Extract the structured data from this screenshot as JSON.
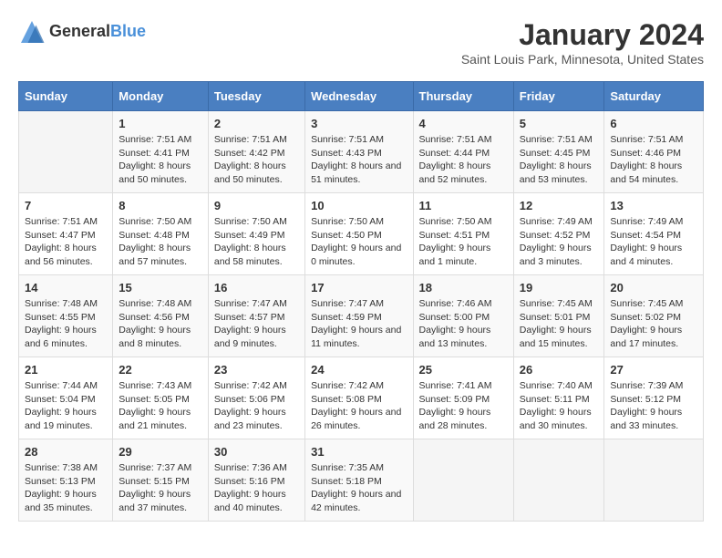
{
  "header": {
    "logo_general": "General",
    "logo_blue": "Blue",
    "month_title": "January 2024",
    "location": "Saint Louis Park, Minnesota, United States"
  },
  "days_of_week": [
    "Sunday",
    "Monday",
    "Tuesday",
    "Wednesday",
    "Thursday",
    "Friday",
    "Saturday"
  ],
  "weeks": [
    [
      {
        "day": "",
        "sunrise": "",
        "sunset": "",
        "daylight": ""
      },
      {
        "day": "1",
        "sunrise": "Sunrise: 7:51 AM",
        "sunset": "Sunset: 4:41 PM",
        "daylight": "Daylight: 8 hours and 50 minutes."
      },
      {
        "day": "2",
        "sunrise": "Sunrise: 7:51 AM",
        "sunset": "Sunset: 4:42 PM",
        "daylight": "Daylight: 8 hours and 50 minutes."
      },
      {
        "day": "3",
        "sunrise": "Sunrise: 7:51 AM",
        "sunset": "Sunset: 4:43 PM",
        "daylight": "Daylight: 8 hours and 51 minutes."
      },
      {
        "day": "4",
        "sunrise": "Sunrise: 7:51 AM",
        "sunset": "Sunset: 4:44 PM",
        "daylight": "Daylight: 8 hours and 52 minutes."
      },
      {
        "day": "5",
        "sunrise": "Sunrise: 7:51 AM",
        "sunset": "Sunset: 4:45 PM",
        "daylight": "Daylight: 8 hours and 53 minutes."
      },
      {
        "day": "6",
        "sunrise": "Sunrise: 7:51 AM",
        "sunset": "Sunset: 4:46 PM",
        "daylight": "Daylight: 8 hours and 54 minutes."
      }
    ],
    [
      {
        "day": "7",
        "sunrise": "Sunrise: 7:51 AM",
        "sunset": "Sunset: 4:47 PM",
        "daylight": "Daylight: 8 hours and 56 minutes."
      },
      {
        "day": "8",
        "sunrise": "Sunrise: 7:50 AM",
        "sunset": "Sunset: 4:48 PM",
        "daylight": "Daylight: 8 hours and 57 minutes."
      },
      {
        "day": "9",
        "sunrise": "Sunrise: 7:50 AM",
        "sunset": "Sunset: 4:49 PM",
        "daylight": "Daylight: 8 hours and 58 minutes."
      },
      {
        "day": "10",
        "sunrise": "Sunrise: 7:50 AM",
        "sunset": "Sunset: 4:50 PM",
        "daylight": "Daylight: 9 hours and 0 minutes."
      },
      {
        "day": "11",
        "sunrise": "Sunrise: 7:50 AM",
        "sunset": "Sunset: 4:51 PM",
        "daylight": "Daylight: 9 hours and 1 minute."
      },
      {
        "day": "12",
        "sunrise": "Sunrise: 7:49 AM",
        "sunset": "Sunset: 4:52 PM",
        "daylight": "Daylight: 9 hours and 3 minutes."
      },
      {
        "day": "13",
        "sunrise": "Sunrise: 7:49 AM",
        "sunset": "Sunset: 4:54 PM",
        "daylight": "Daylight: 9 hours and 4 minutes."
      }
    ],
    [
      {
        "day": "14",
        "sunrise": "Sunrise: 7:48 AM",
        "sunset": "Sunset: 4:55 PM",
        "daylight": "Daylight: 9 hours and 6 minutes."
      },
      {
        "day": "15",
        "sunrise": "Sunrise: 7:48 AM",
        "sunset": "Sunset: 4:56 PM",
        "daylight": "Daylight: 9 hours and 8 minutes."
      },
      {
        "day": "16",
        "sunrise": "Sunrise: 7:47 AM",
        "sunset": "Sunset: 4:57 PM",
        "daylight": "Daylight: 9 hours and 9 minutes."
      },
      {
        "day": "17",
        "sunrise": "Sunrise: 7:47 AM",
        "sunset": "Sunset: 4:59 PM",
        "daylight": "Daylight: 9 hours and 11 minutes."
      },
      {
        "day": "18",
        "sunrise": "Sunrise: 7:46 AM",
        "sunset": "Sunset: 5:00 PM",
        "daylight": "Daylight: 9 hours and 13 minutes."
      },
      {
        "day": "19",
        "sunrise": "Sunrise: 7:45 AM",
        "sunset": "Sunset: 5:01 PM",
        "daylight": "Daylight: 9 hours and 15 minutes."
      },
      {
        "day": "20",
        "sunrise": "Sunrise: 7:45 AM",
        "sunset": "Sunset: 5:02 PM",
        "daylight": "Daylight: 9 hours and 17 minutes."
      }
    ],
    [
      {
        "day": "21",
        "sunrise": "Sunrise: 7:44 AM",
        "sunset": "Sunset: 5:04 PM",
        "daylight": "Daylight: 9 hours and 19 minutes."
      },
      {
        "day": "22",
        "sunrise": "Sunrise: 7:43 AM",
        "sunset": "Sunset: 5:05 PM",
        "daylight": "Daylight: 9 hours and 21 minutes."
      },
      {
        "day": "23",
        "sunrise": "Sunrise: 7:42 AM",
        "sunset": "Sunset: 5:06 PM",
        "daylight": "Daylight: 9 hours and 23 minutes."
      },
      {
        "day": "24",
        "sunrise": "Sunrise: 7:42 AM",
        "sunset": "Sunset: 5:08 PM",
        "daylight": "Daylight: 9 hours and 26 minutes."
      },
      {
        "day": "25",
        "sunrise": "Sunrise: 7:41 AM",
        "sunset": "Sunset: 5:09 PM",
        "daylight": "Daylight: 9 hours and 28 minutes."
      },
      {
        "day": "26",
        "sunrise": "Sunrise: 7:40 AM",
        "sunset": "Sunset: 5:11 PM",
        "daylight": "Daylight: 9 hours and 30 minutes."
      },
      {
        "day": "27",
        "sunrise": "Sunrise: 7:39 AM",
        "sunset": "Sunset: 5:12 PM",
        "daylight": "Daylight: 9 hours and 33 minutes."
      }
    ],
    [
      {
        "day": "28",
        "sunrise": "Sunrise: 7:38 AM",
        "sunset": "Sunset: 5:13 PM",
        "daylight": "Daylight: 9 hours and 35 minutes."
      },
      {
        "day": "29",
        "sunrise": "Sunrise: 7:37 AM",
        "sunset": "Sunset: 5:15 PM",
        "daylight": "Daylight: 9 hours and 37 minutes."
      },
      {
        "day": "30",
        "sunrise": "Sunrise: 7:36 AM",
        "sunset": "Sunset: 5:16 PM",
        "daylight": "Daylight: 9 hours and 40 minutes."
      },
      {
        "day": "31",
        "sunrise": "Sunrise: 7:35 AM",
        "sunset": "Sunset: 5:18 PM",
        "daylight": "Daylight: 9 hours and 42 minutes."
      },
      {
        "day": "",
        "sunrise": "",
        "sunset": "",
        "daylight": ""
      },
      {
        "day": "",
        "sunrise": "",
        "sunset": "",
        "daylight": ""
      },
      {
        "day": "",
        "sunrise": "",
        "sunset": "",
        "daylight": ""
      }
    ]
  ]
}
